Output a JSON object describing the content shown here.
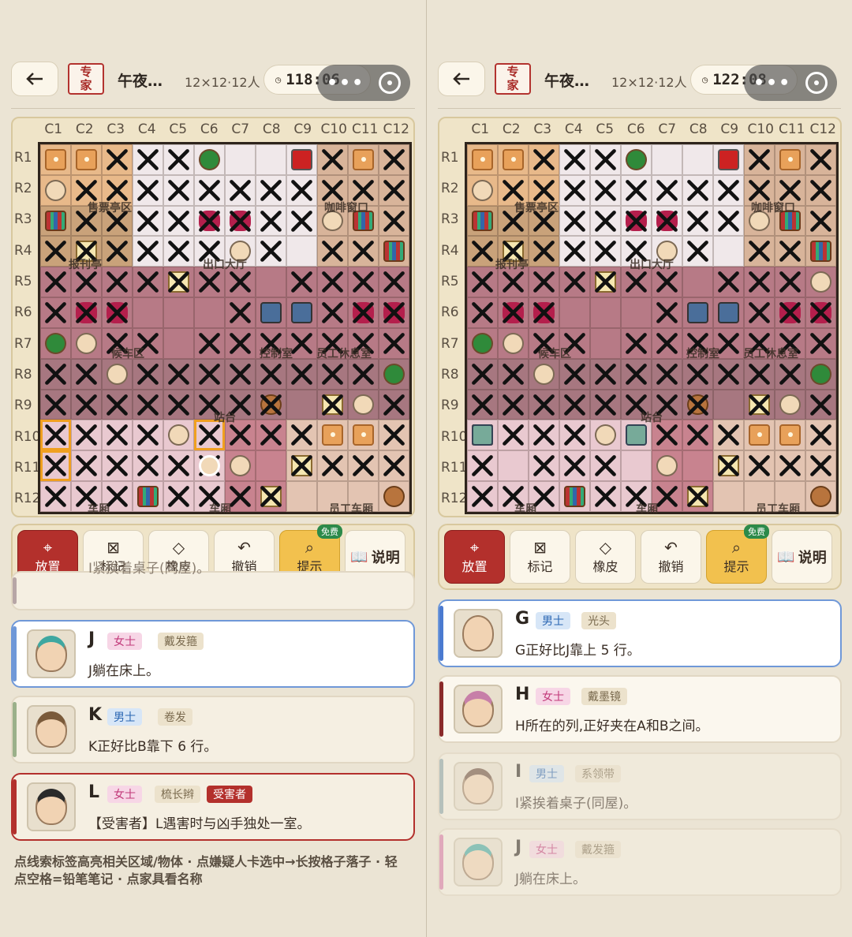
{
  "common": {
    "difficulty": "专家",
    "difficulty_line1": "专",
    "difficulty_line2": "家",
    "title": "午夜…",
    "size": "12×12·12人",
    "columns": [
      "C1",
      "C2",
      "C3",
      "C4",
      "C5",
      "C6",
      "C7",
      "C8",
      "C9",
      "C10",
      "C11",
      "C12"
    ],
    "rows": [
      "R1",
      "R2",
      "R3",
      "R4",
      "R5",
      "R6",
      "R7",
      "R8",
      "R9",
      "R10",
      "R11",
      "R12"
    ],
    "zones": [
      "售票亭区",
      "咖啡窗口",
      "报刊亭",
      "出口大厅",
      "候车区",
      "控制室",
      "员工休息室",
      "站台",
      "车厢",
      "车厢",
      "员工车厢"
    ],
    "tools": {
      "place": "放置",
      "mark": "标记",
      "erase": "橡皮",
      "undo": "撤销",
      "hint": "提示",
      "hint_badge": "免费",
      "help": "说明"
    }
  },
  "left": {
    "timer": "118:06",
    "cards": [
      {
        "id": "I",
        "partial_text": "I紧挨着桌子(同屋)。"
      },
      {
        "id": "J",
        "gender": "女士",
        "trait": "戴发箍",
        "text": "J躺在床上。"
      },
      {
        "id": "K",
        "gender": "男士",
        "trait": "卷发",
        "text": "K正好比B靠下 6 行。"
      },
      {
        "id": "L",
        "gender": "女士",
        "trait": "梳长辫",
        "victim": "受害者",
        "text": "【受害者】L遇害时与凶手独处一室。"
      }
    ],
    "hint": "点线索标签高亮相关区域/物体 · 点嫌疑人卡选中→长按格子落子 · 轻点空格=铅笔笔记 · 点家具看名称"
  },
  "right": {
    "timer": "122:08",
    "cards": [
      {
        "id": "G",
        "gender": "男士",
        "trait": "光头",
        "text": "G正好比J靠上 5 行。"
      },
      {
        "id": "H",
        "gender": "女士",
        "trait": "戴墨镜",
        "text": "H所在的列,正好夹在A和B之间。"
      },
      {
        "id": "I",
        "gender": "男士",
        "trait": "系领带",
        "text": "I紧挨着桌子(同屋)。"
      },
      {
        "id": "J",
        "gender": "女士",
        "trait": "戴发箍",
        "text": "J躺在床上。"
      }
    ]
  },
  "colors": {
    "accent": "#b3302c",
    "hint": "#f2c14e",
    "board_border": "#2e241c",
    "background": "#ebe4d4"
  }
}
